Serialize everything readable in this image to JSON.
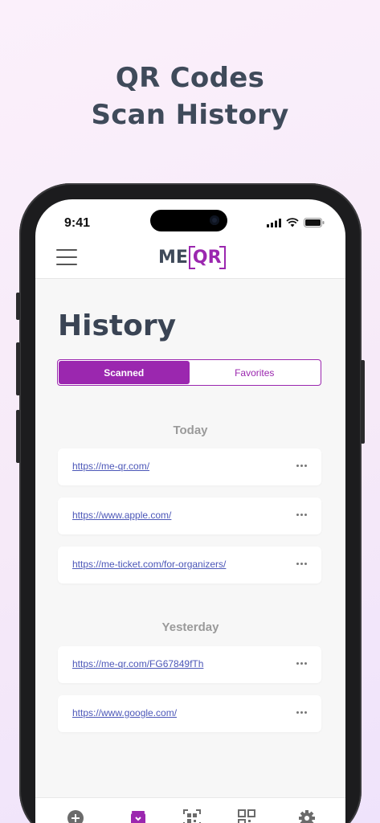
{
  "headline": {
    "line1": "QR Codes",
    "line2": "Scan History"
  },
  "status_bar": {
    "time": "9:41"
  },
  "app": {
    "logo_left": "ME",
    "logo_right": "QR",
    "page_title": "History"
  },
  "tabs": {
    "scanned": "Scanned",
    "favorites": "Favorites",
    "active": "scanned"
  },
  "sections": [
    {
      "label": "Today",
      "items": [
        "https://me-qr.com/",
        "https://www.apple.com/",
        "https://me-ticket.com/for-organizers/"
      ]
    },
    {
      "label": "Yesterday",
      "items": [
        "https://me-qr.com/FG67849fTh",
        "https://www.google.com/"
      ]
    }
  ],
  "bottom_nav": [
    "add-icon",
    "history-icon",
    "scan-icon",
    "qr-code-icon",
    "settings-icon"
  ],
  "colors": {
    "accent": "#9b27af",
    "title": "#3a4454",
    "link": "#4c57b8",
    "background": "#f7eef9"
  }
}
